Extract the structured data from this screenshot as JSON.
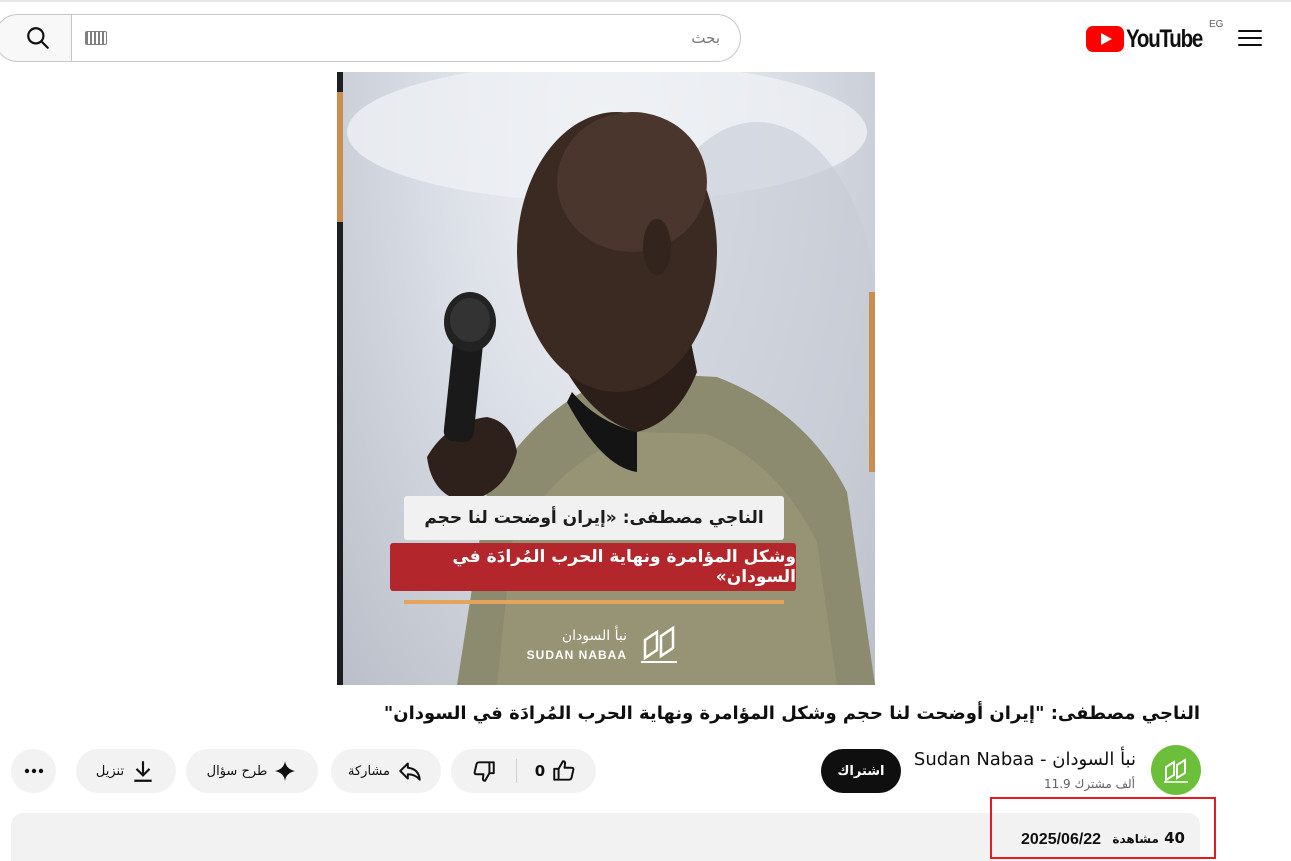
{
  "header": {
    "logo_text": "YouTube",
    "region_code": "EG",
    "search_placeholder": "بحث"
  },
  "video": {
    "caption_line1": "الناجي مصطفى: «إيران أوضحت لنا حجم",
    "caption_line2": "وشكل المؤامرة ونهاية الحرب المُرادَة في السودان»",
    "watermark_ar": "نبأ السودان",
    "watermark_en": "SUDAN NABAA"
  },
  "title": "الناجي مصطفى: \"إيران أوضحت لنا حجم وشكل المؤامرة ونهاية الحرب المُرادَة في السودان\"",
  "channel": {
    "name": "نبأ السودان - Sudan Nabaa",
    "subscribers": "11.9 ألف مشترك",
    "subscribe_label": "اشتراك"
  },
  "actions": {
    "like_count": "0",
    "share_label": "مشاركة",
    "ask_label": "طرح سؤال",
    "download_label": "تنزيل"
  },
  "description": {
    "views_count": "40",
    "views_label": "مشاهدة",
    "date": "2025/06/22"
  },
  "colors": {
    "brand_red": "#ff0000",
    "highlight": "#e31b23",
    "avatar_green": "#6cbf3a"
  }
}
